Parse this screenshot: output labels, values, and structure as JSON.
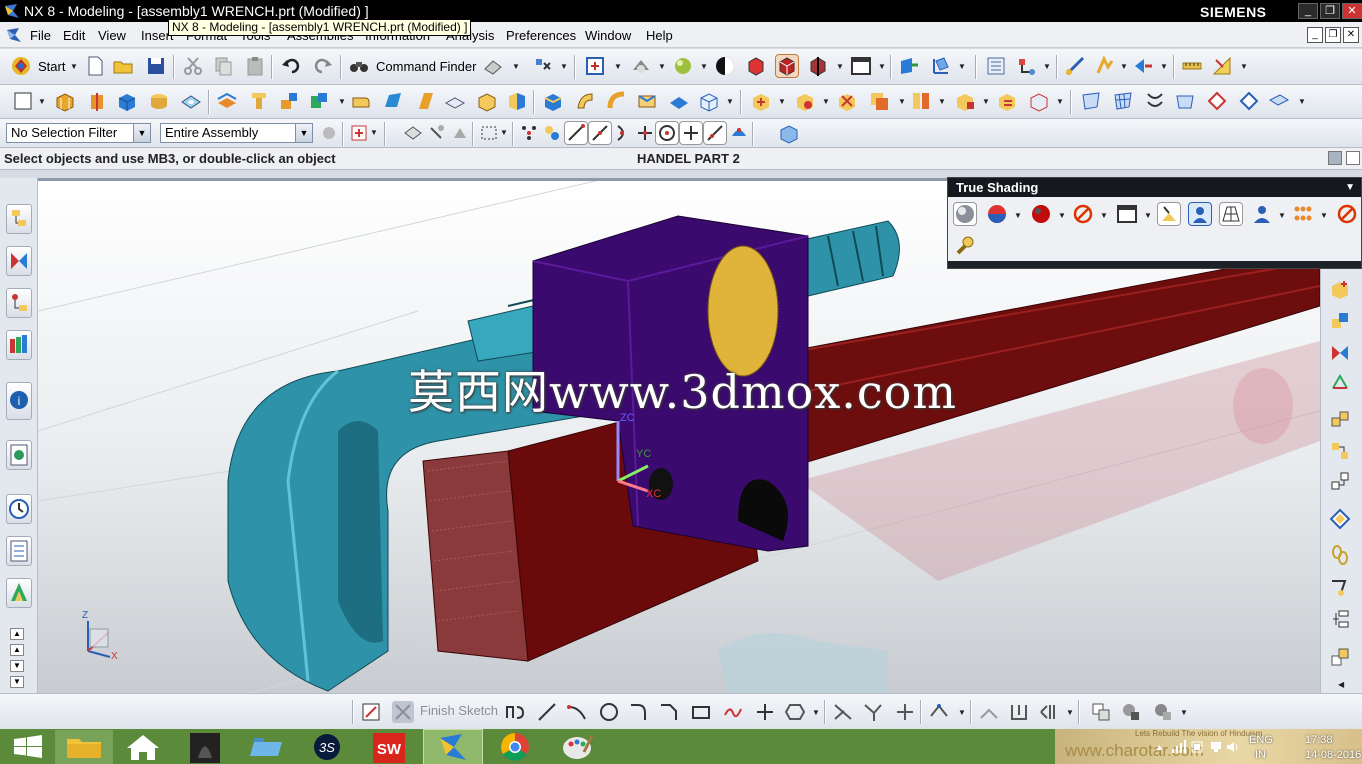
{
  "window": {
    "title": "NX 8 - Modeling - [assembly1 WRENCH.prt (Modified) ]",
    "tooltip": "NX 8 - Modeling - [assembly1 WRENCH.prt (Modified) ]",
    "brand": "SIEMENS",
    "controls": [
      "_",
      "❐",
      "✕"
    ]
  },
  "menu": {
    "items": [
      "File",
      "Edit",
      "View",
      "Insert",
      "Format",
      "Tools",
      "Assemblies",
      "Information",
      "Analysis",
      "Preferences",
      "Window",
      "Help"
    ],
    "mdi_controls": [
      "_",
      "❐",
      "✕"
    ]
  },
  "toolbar_standard": {
    "start_label": "Start",
    "command_finder_label": "Command Finder"
  },
  "selection_bar": {
    "filter": "No Selection Filter",
    "scope": "Entire Assembly"
  },
  "status": {
    "cue": "Select objects and use MB3, or double-click an object",
    "part_name": "HANDEL PART 2"
  },
  "graphics": {
    "watermark": "莫西网www.3dmox.com",
    "wcs_labels": {
      "zc": "ZC",
      "yc": "YC",
      "xc": "XC"
    },
    "triad_labels": {
      "z": "Z",
      "x": "X"
    },
    "colors": {
      "jaw": "#2e93a8",
      "handle": "#6e0d0d",
      "nut": "#3b0a6e",
      "knurl": "#e0b43a",
      "serration": "#8a3a3a"
    }
  },
  "true_shading": {
    "title": "True Shading"
  },
  "sketch_bar": {
    "finish_sketch_label": "Finish Sketch"
  },
  "taskbar": {
    "apps": [
      "start-icon",
      "file-explorer-icon",
      "home-icon",
      "assassins-icon",
      "folder-icon",
      "3ds-icon",
      "solidworks-icon",
      "nx-icon",
      "chrome-icon",
      "paint-icon"
    ],
    "language": "ENG",
    "region": "IN",
    "time": "17:38",
    "date": "14-08-2016",
    "tray_watermark": "www.charotar.com",
    "tray_slogan": "Lets Rebuild The vision of Hinduism"
  }
}
